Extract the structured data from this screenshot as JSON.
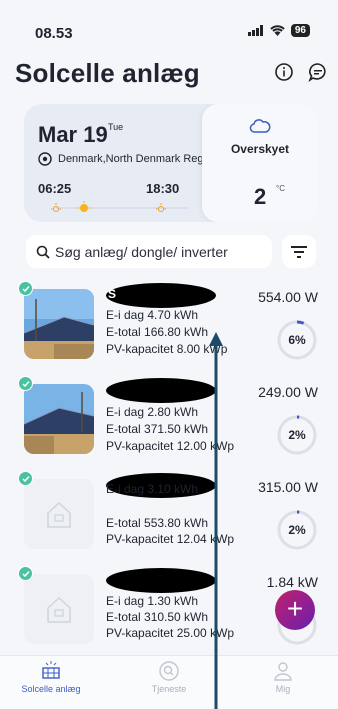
{
  "status_bar": {
    "time": "08.53",
    "battery": "96"
  },
  "header": {
    "title": "Solcelle anlæg"
  },
  "weather": {
    "date": "Mar 19",
    "weekday": "Tue",
    "location": "Denmark,North Denmark Reg",
    "sunrise": "06:25",
    "sunset": "18:30",
    "condition": "Overskyet",
    "temperature": "2",
    "unit": "°C"
  },
  "search": {
    "placeholder": "Søg anlæg/ dongle/ inverter"
  },
  "plants": [
    {
      "title": "S",
      "e_day": "E-i dag 4.70 kWh",
      "e_total": "E-total 166.80 kWh",
      "pv_capacity": "PV-kapacitet 8.00 kWp",
      "power": "554.00 W",
      "percent": "6%",
      "percent_value": 6,
      "has_photo": true
    },
    {
      "title": "",
      "e_day": "E-i dag 2.80 kWh",
      "e_total": "E-total 371.50 kWh",
      "pv_capacity": "PV-kapacitet 12.00 kWp",
      "power": "249.00 W",
      "percent": "2%",
      "percent_value": 2,
      "has_photo": true
    },
    {
      "title": "",
      "e_day": "E-i dag 3.10 kWh",
      "e_total": "E-total 553.80 kWh",
      "pv_capacity": "PV-kapacitet 12.04 kWp",
      "power": "315.00 W",
      "percent": "2%",
      "percent_value": 2,
      "has_photo": false
    },
    {
      "title": "",
      "e_day": "E-i dag 1.30 kWh",
      "e_total": "E-total 310.50 kWh",
      "pv_capacity": "PV-kapacitet 25.00 kWp",
      "power": "1.84 kW",
      "percent": "",
      "percent_value": 0,
      "has_photo": false
    }
  ],
  "nav": {
    "items": [
      {
        "label": "Solcelle anlæg",
        "active": true,
        "icon": "solar-panel-icon"
      },
      {
        "label": "Tjeneste",
        "active": false,
        "icon": "service-icon"
      },
      {
        "label": "Mig",
        "active": false,
        "icon": "user-icon"
      }
    ]
  },
  "colors": {
    "accent": "#3d5bc8",
    "check": "#48c2a0",
    "fab_start": "#c0206b",
    "fab_end": "#6a1fb0"
  }
}
